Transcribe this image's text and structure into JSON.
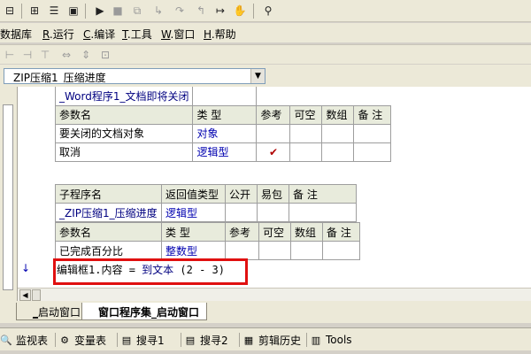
{
  "menu": [
    {
      "label": "数据库",
      "key": ".",
      "tail": "数据库"
    },
    {
      "label": "R.运行",
      "key": "R",
      "tail": ".运行"
    },
    {
      "label": "C.编译",
      "key": "C",
      "tail": ".编译"
    },
    {
      "label": "T.工具",
      "key": "T",
      "tail": ".工具"
    },
    {
      "label": "W.窗口",
      "key": "W",
      "tail": ".窗口"
    },
    {
      "label": "H.帮助",
      "key": "H",
      "tail": ".帮助"
    }
  ],
  "dropdown": {
    "value": "_ZIP压缩1_压缩进度"
  },
  "table1": {
    "event_row": "_Word程序1_文档即将关闭",
    "headers": [
      "参数名",
      "类 型",
      "参考",
      "可空",
      "数组",
      "备 注"
    ],
    "rows": [
      {
        "name": "要关闭的文档对象",
        "type": "对象",
        "ref": ""
      },
      {
        "name": "取消",
        "type": "逻辑型",
        "ref": "✔"
      }
    ]
  },
  "table2": {
    "headers": [
      "子程序名",
      "返回值类型",
      "公开",
      "易包",
      "备 注"
    ],
    "sub": {
      "name": "_ZIP压缩1_压缩进度",
      "return": "逻辑型"
    },
    "param_headers": [
      "参数名",
      "类 型",
      "参考",
      "可空",
      "数组",
      "备 注"
    ],
    "param": {
      "name": "已完成百分比",
      "type": "整数型"
    }
  },
  "code": {
    "target": "编辑框1.内容",
    "op": "=",
    "func": "到文本",
    "args": "(2 - 3)"
  },
  "tabs": [
    {
      "key": "_",
      "label": "启动窗口"
    },
    {
      "key": "",
      "label": "窗口程序集_启动窗口"
    }
  ],
  "bottom": [
    {
      "label": "监视表",
      "icon": "magnifier-icon"
    },
    {
      "label": "变量表",
      "icon": "variables-icon"
    },
    {
      "label": "搜寻1",
      "icon": "search1-icon"
    },
    {
      "label": "搜寻2",
      "icon": "search2-icon"
    },
    {
      "label": "剪辑历史",
      "icon": "clipboard-icon"
    },
    {
      "label": "Tools",
      "icon": "tools-icon"
    }
  ],
  "colors": {
    "highlight_box": "#e01010",
    "keyword": "#0000b0"
  }
}
